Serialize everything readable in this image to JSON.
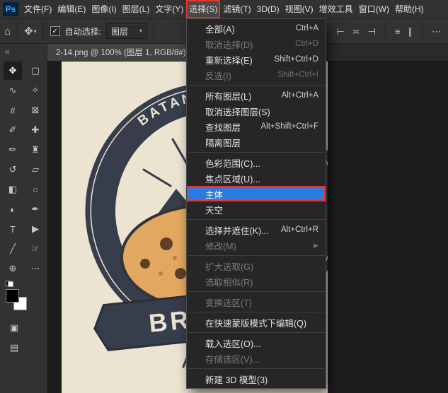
{
  "app": {
    "logo": "Ps"
  },
  "menubar": {
    "items": [
      {
        "name": "file",
        "label": "文件(F)"
      },
      {
        "name": "edit",
        "label": "编辑(E)"
      },
      {
        "name": "image",
        "label": "图像(I)"
      },
      {
        "name": "layer",
        "label": "图层(L)"
      },
      {
        "name": "type",
        "label": "文字(Y)"
      },
      {
        "name": "select",
        "label": "选择(S)",
        "active": true
      },
      {
        "name": "filter",
        "label": "滤镜(T)"
      },
      {
        "name": "3d",
        "label": "3D(D)"
      },
      {
        "name": "view",
        "label": "视图(V)"
      },
      {
        "name": "plugins",
        "label": "增效工具"
      },
      {
        "name": "window",
        "label": "窗口(W)"
      },
      {
        "name": "help",
        "label": "帮助(H)"
      }
    ]
  },
  "options_bar": {
    "home_glyph": "⌂",
    "tool_glyph": "✥",
    "caret_glyph": "▾",
    "auto_select_checked": true,
    "checkbox_glyph": "✓",
    "auto_select_label": "自动选择:",
    "target_value": "图层",
    "right_icons": [
      {
        "name": "align-left-icon",
        "glyph": "⊢"
      },
      {
        "name": "align-center-h-icon",
        "glyph": "≍"
      },
      {
        "name": "align-right-icon",
        "glyph": "⊣"
      },
      {
        "type": "divider"
      },
      {
        "name": "distribute-vertical-icon",
        "glyph": "≡"
      },
      {
        "name": "distribute-horizontal-icon",
        "glyph": "∥"
      },
      {
        "type": "divider"
      },
      {
        "name": "more-options-icon",
        "glyph": "⋯"
      }
    ]
  },
  "tools_panel": {
    "collapse_glyph": "«",
    "tools": [
      {
        "name": "move-tool",
        "glyph": "✥",
        "selected": true
      },
      {
        "name": "rectangular-marquee-tool",
        "glyph": "▢"
      },
      {
        "name": "lasso-tool",
        "glyph": "∿"
      },
      {
        "name": "quick-selection-tool",
        "glyph": "✧"
      },
      {
        "name": "crop-tool",
        "glyph": "#"
      },
      {
        "name": "frame-tool",
        "glyph": "⊠"
      },
      {
        "name": "eyedropper-tool",
        "glyph": "✐"
      },
      {
        "name": "healing-brush-tool",
        "glyph": "✚"
      },
      {
        "name": "brush-tool",
        "glyph": "✏"
      },
      {
        "name": "clone-stamp-tool",
        "glyph": "♜"
      },
      {
        "name": "history-brush-tool",
        "glyph": "↺"
      },
      {
        "name": "eraser-tool",
        "glyph": "▱"
      },
      {
        "name": "gradient-tool",
        "glyph": "◧"
      },
      {
        "name": "blur-tool",
        "glyph": "○"
      },
      {
        "name": "dodge-tool",
        "glyph": "◐"
      },
      {
        "name": "pen-tool",
        "glyph": "✒"
      },
      {
        "name": "type-tool",
        "glyph": "T"
      },
      {
        "name": "path-selection-tool",
        "glyph": "▶"
      },
      {
        "name": "line-tool",
        "glyph": "╱"
      },
      {
        "name": "hand-tool",
        "glyph": "☞"
      },
      {
        "name": "zoom-tool",
        "glyph": "⊕"
      },
      {
        "name": "edit-toolbar-icon",
        "glyph": "⋯"
      }
    ],
    "bottom_tools": [
      {
        "name": "quick-mask-icon",
        "glyph": "▣"
      },
      {
        "name": "screen-mode-icon",
        "glyph": "▤"
      }
    ],
    "foreground_color": "#000000",
    "background_color": "#ffffff"
  },
  "document": {
    "tab_title": "2-14.png @ 100% (图层 1, RGB/8#)"
  },
  "canvas": {
    "badge_arc_text": "BATANB BELIEVE",
    "banner_text": "BRART",
    "colors": {
      "paper": "#ece4d1",
      "ink": "#363d4b",
      "cookie": "#e2a85f",
      "cookie_back": "#d79a50",
      "chip": "#5f4026"
    }
  },
  "select_menu": {
    "accent_blue": "#2a7ce0",
    "annotation_red": "#e8342c",
    "items": [
      {
        "label": "全部(A)",
        "shortcut": "Ctrl+A",
        "enabled": true
      },
      {
        "label": "取消选择(D)",
        "shortcut": "Ctrl+D",
        "enabled": false
      },
      {
        "label": "重新选择(E)",
        "shortcut": "Shift+Ctrl+D",
        "enabled": true
      },
      {
        "label": "反选(I)",
        "shortcut": "Shift+Ctrl+I",
        "enabled": false
      },
      {
        "divider": true
      },
      {
        "label": "所有图层(L)",
        "shortcut": "Alt+Ctrl+A",
        "enabled": true
      },
      {
        "label": "取消选择图层(S)",
        "shortcut": "",
        "enabled": true
      },
      {
        "label": "查找图层",
        "shortcut": "Alt+Shift+Ctrl+F",
        "enabled": true
      },
      {
        "label": "隔离图层",
        "shortcut": "",
        "enabled": true
      },
      {
        "divider": true
      },
      {
        "label": "色彩范围(C)...",
        "shortcut": "",
        "enabled": true
      },
      {
        "label": "焦点区域(U)...",
        "shortcut": "",
        "enabled": true
      },
      {
        "label": "主体",
        "shortcut": "",
        "enabled": true,
        "highlighted": true,
        "annotated": true
      },
      {
        "label": "天空",
        "shortcut": "",
        "enabled": true
      },
      {
        "divider": true
      },
      {
        "label": "选择并遮住(K)...",
        "shortcut": "Alt+Ctrl+R",
        "enabled": true
      },
      {
        "label": "修改(M)",
        "shortcut": "",
        "enabled": false,
        "submenu": true
      },
      {
        "divider": true
      },
      {
        "label": "扩大选取(G)",
        "shortcut": "",
        "enabled": false
      },
      {
        "label": "选取相似(R)",
        "shortcut": "",
        "enabled": false
      },
      {
        "divider": true
      },
      {
        "label": "变换选区(T)",
        "shortcut": "",
        "enabled": false
      },
      {
        "divider": true
      },
      {
        "label": "在快速蒙版模式下编辑(Q)",
        "shortcut": "",
        "enabled": true
      },
      {
        "divider": true
      },
      {
        "label": "载入选区(O)...",
        "shortcut": "",
        "enabled": true
      },
      {
        "label": "存储选区(V)...",
        "shortcut": "",
        "enabled": false
      },
      {
        "divider": true
      },
      {
        "label": "新建 3D 模型(3)",
        "shortcut": "",
        "enabled": true
      }
    ]
  }
}
